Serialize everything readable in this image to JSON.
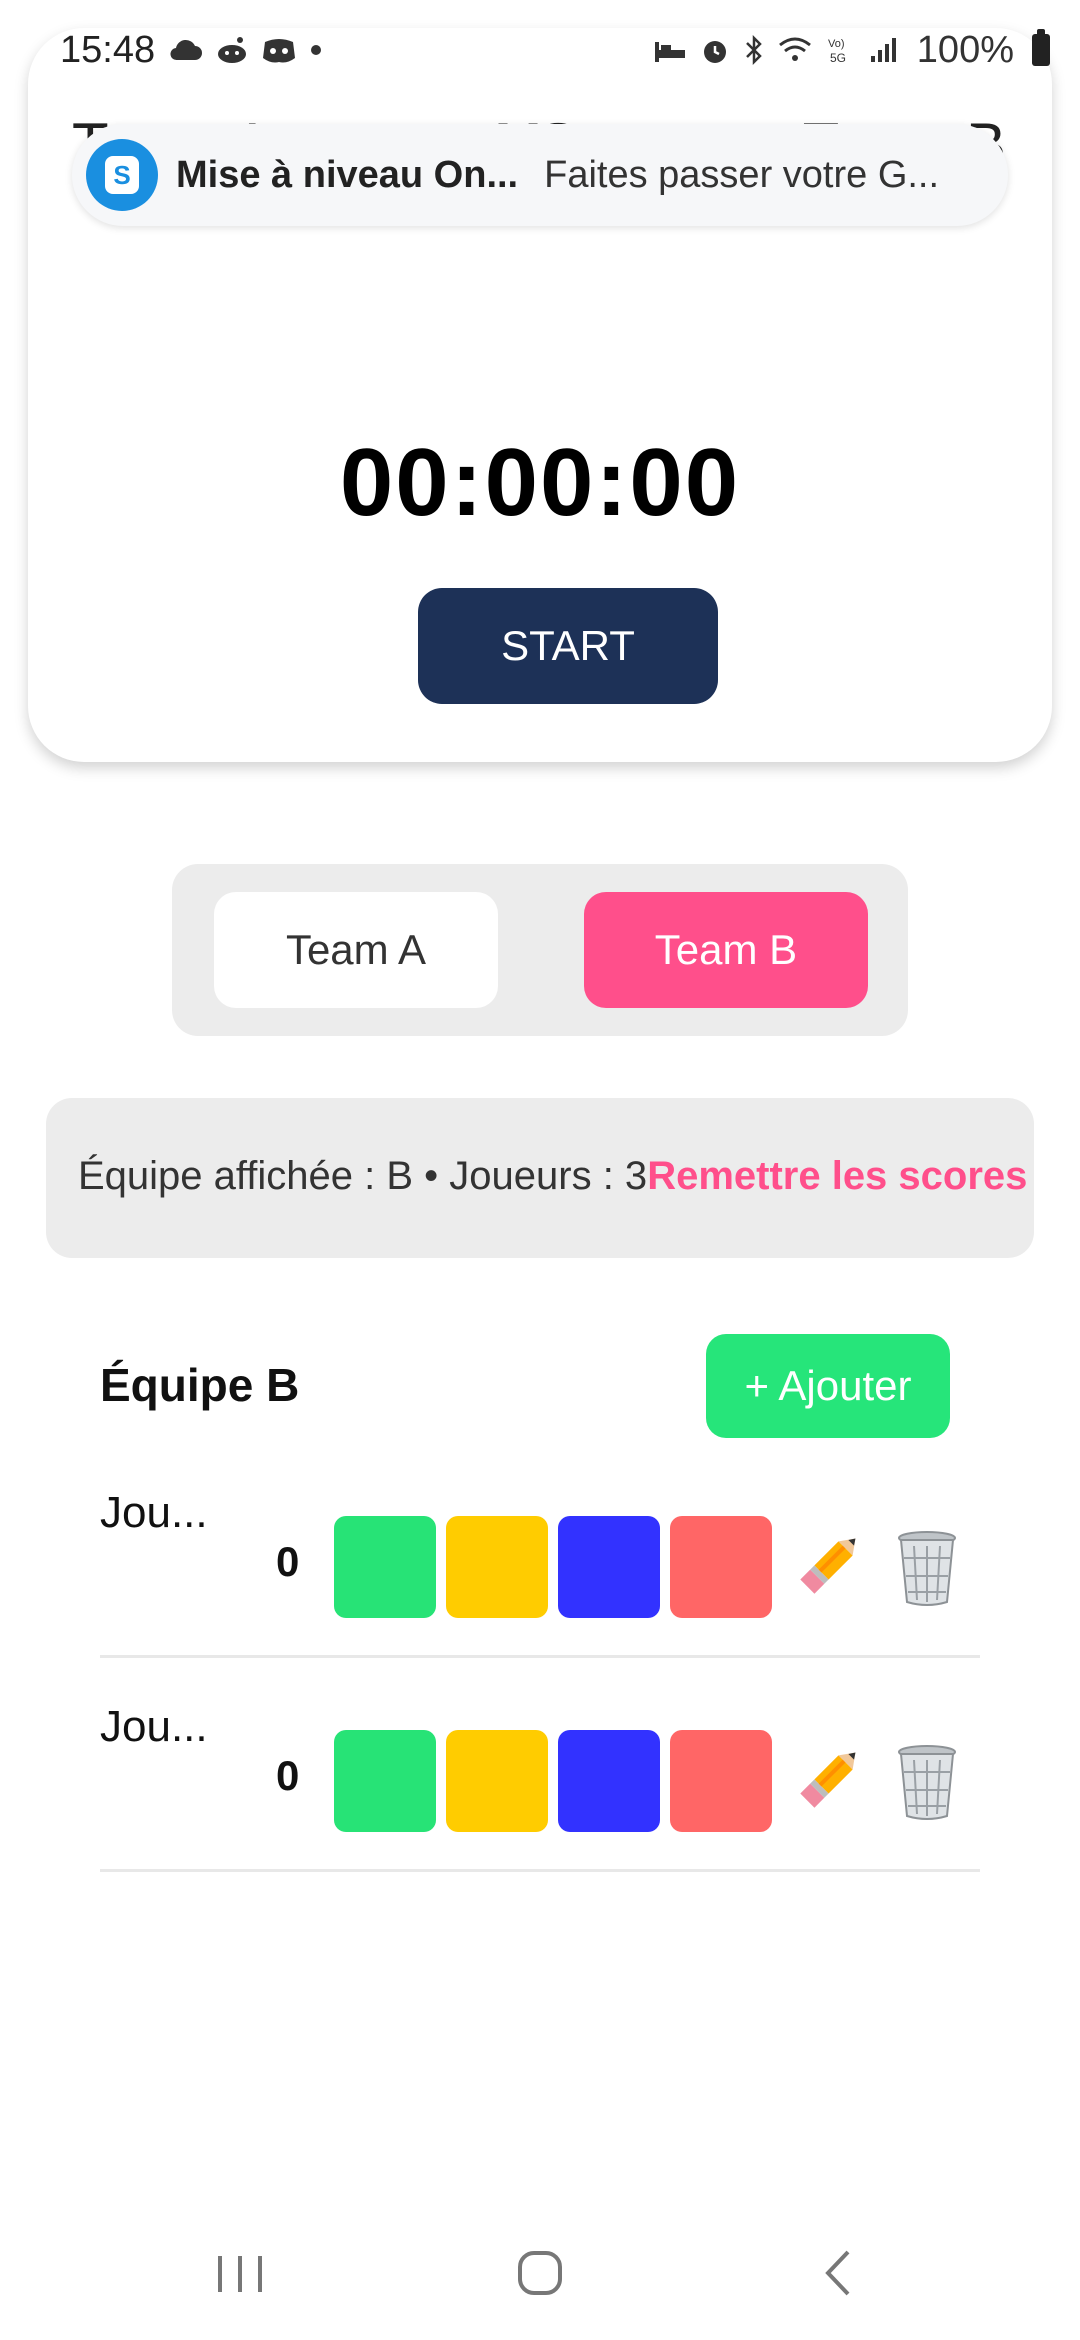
{
  "status_bar": {
    "time": "15:48",
    "battery": "100%",
    "left_icons": [
      "cloud-icon",
      "reddit-icon",
      "discord-icon",
      "dot-icon"
    ],
    "right_icons": [
      "sleep-icon",
      "alarm-icon",
      "bluetooth-icon",
      "wifi-icon",
      "volte-5g-icon",
      "signal-icon",
      "battery-icon"
    ]
  },
  "header": {
    "team_a": "Team A",
    "vs": "VS",
    "team_b": "Team B"
  },
  "notification": {
    "icon_letter": "S",
    "title": "Mise à niveau On...",
    "body": "Faites passer votre G..."
  },
  "timer": {
    "value": "00:00:00",
    "start_label": "START"
  },
  "team_toggle": {
    "team_a": "Team A",
    "team_b": "Team B",
    "selected": "Team B",
    "selected_color": "#ff4f8b"
  },
  "info": {
    "text": "Équipe affichée : B • Joueurs : 3",
    "reset_label": "Remettre les scores"
  },
  "team_section": {
    "title": "Équipe B",
    "add_label": "+ Ajouter",
    "players": [
      {
        "name": "Jou...",
        "score": "0"
      },
      {
        "name": "Jou...",
        "score": "0"
      }
    ],
    "score_colors": [
      "#27e376",
      "#ffcc00",
      "#3232ff",
      "#ff6666"
    ]
  },
  "nav": {
    "items": [
      "recent-apps-icon",
      "home-icon",
      "back-icon"
    ]
  }
}
